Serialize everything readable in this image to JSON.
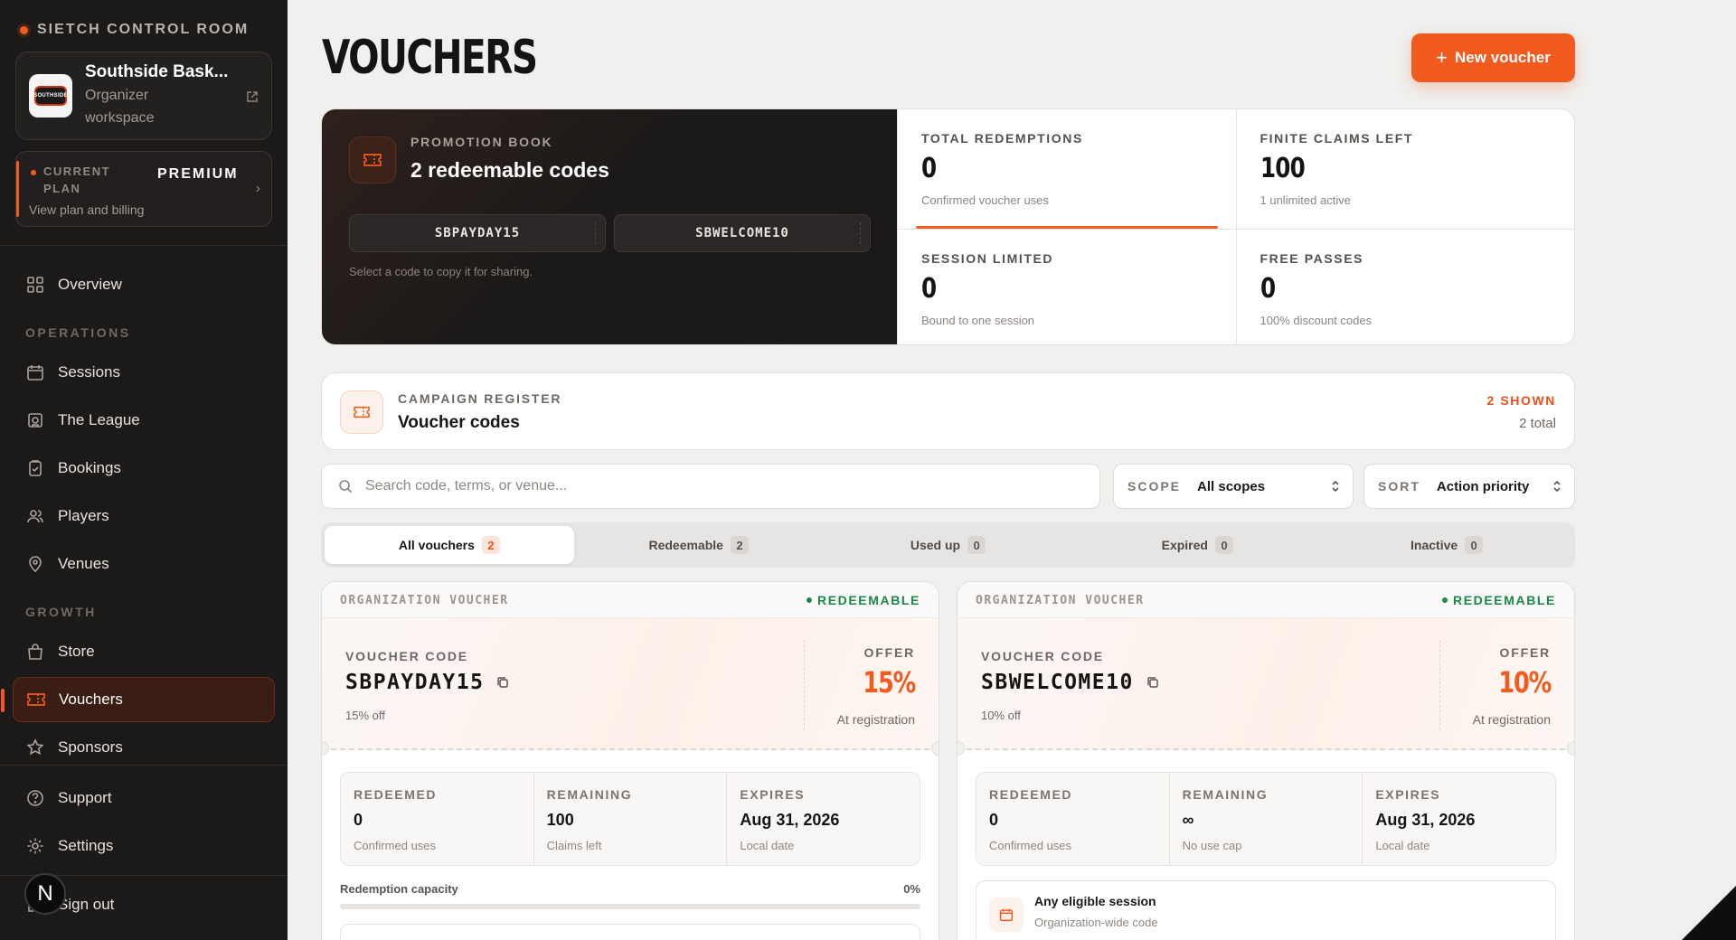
{
  "sidebar": {
    "brand": "SIETCH CONTROL ROOM",
    "workspace": {
      "name": "Southside Bask...",
      "role_line1": "Organizer",
      "role_line2": "workspace",
      "logo_text": "SOUTHSIDE"
    },
    "plan": {
      "label_line1": "CURRENT",
      "label_line2": "PLAN",
      "tier": "PREMIUM",
      "link": "View plan and billing"
    },
    "overview": "Overview",
    "sections": {
      "operations": "OPERATIONS",
      "growth": "GROWTH"
    },
    "operations_items": [
      "Sessions",
      "The League",
      "Bookings",
      "Players",
      "Venues"
    ],
    "growth_items": [
      "Store",
      "Vouchers",
      "Sponsors"
    ],
    "bottom_items": [
      "Support",
      "Settings"
    ],
    "sign_out": "Sign out",
    "avatar_initial": "N"
  },
  "header": {
    "title": "VOUCHERS",
    "new_button": "New voucher"
  },
  "promotion": {
    "eyebrow": "PROMOTION BOOK",
    "title": "2 redeemable codes",
    "codes": [
      "SBPAYDAY15",
      "SBWELCOME10"
    ],
    "hint": "Select a code to copy it for sharing."
  },
  "stats": [
    {
      "label": "TOTAL REDEMPTIONS",
      "value": "0",
      "sub": "Confirmed voucher uses"
    },
    {
      "label": "FINITE CLAIMS LEFT",
      "value": "100",
      "sub": "1 unlimited active"
    },
    {
      "label": "SESSION LIMITED",
      "value": "0",
      "sub": "Bound to one session"
    },
    {
      "label": "FREE PASSES",
      "value": "0",
      "sub": "100% discount codes"
    }
  ],
  "register": {
    "eyebrow": "CAMPAIGN REGISTER",
    "title": "Voucher codes",
    "shown": "2 SHOWN",
    "total": "2 total"
  },
  "filters": {
    "search_placeholder": "Search code, terms, or venue...",
    "scope": {
      "label": "SCOPE",
      "value": "All scopes"
    },
    "sort": {
      "label": "SORT",
      "value": "Action priority"
    }
  },
  "tabs": [
    {
      "label": "All vouchers",
      "count": "2"
    },
    {
      "label": "Redeemable",
      "count": "2"
    },
    {
      "label": "Used up",
      "count": "0"
    },
    {
      "label": "Expired",
      "count": "0"
    },
    {
      "label": "Inactive",
      "count": "0"
    }
  ],
  "vouchers": [
    {
      "org_label": "ORGANIZATION VOUCHER",
      "status": "REDEEMABLE",
      "code_label": "VOUCHER CODE",
      "code": "SBPAYDAY15",
      "desc": "15% off",
      "offer_label": "OFFER",
      "offer": "15%",
      "offer_sub": "At registration",
      "metrics": [
        {
          "label": "REDEEMED",
          "value": "0",
          "sub": "Confirmed uses"
        },
        {
          "label": "REMAINING",
          "value": "100",
          "sub": "Claims left"
        },
        {
          "label": "EXPIRES",
          "value": "Aug 31, 2026",
          "sub": "Local date"
        }
      ],
      "capacity_label": "Redemption capacity",
      "capacity_pct": "0%",
      "capacity_fraction": 0
    },
    {
      "org_label": "ORGANIZATION VOUCHER",
      "status": "REDEEMABLE",
      "code_label": "VOUCHER CODE",
      "code": "SBWELCOME10",
      "desc": "10% off",
      "offer_label": "OFFER",
      "offer": "10%",
      "offer_sub": "At registration",
      "metrics": [
        {
          "label": "REDEEMED",
          "value": "0",
          "sub": "Confirmed uses"
        },
        {
          "label": "REMAINING",
          "value": "∞",
          "sub": "No use cap"
        },
        {
          "label": "EXPIRES",
          "value": "Aug 31, 2026",
          "sub": "Local date"
        }
      ],
      "session_title": "Any eligible session",
      "session_sub": "Organization-wide code"
    }
  ],
  "colors": {
    "accent": "#f25a1e",
    "sidebar_bg": "#1c1a19",
    "success": "#17874a"
  }
}
